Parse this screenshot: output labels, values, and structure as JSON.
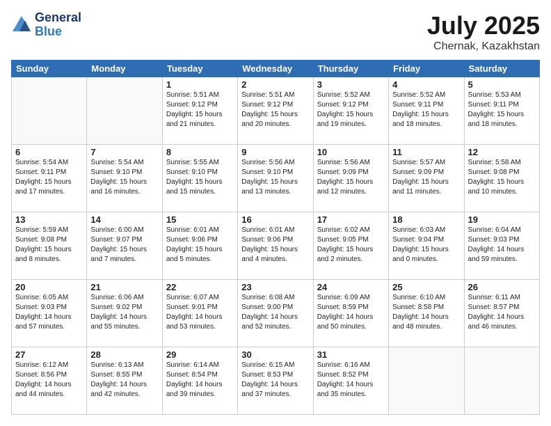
{
  "header": {
    "logo_line1": "General",
    "logo_line2": "Blue",
    "title": "July 2025",
    "subtitle": "Chernak, Kazakhstan"
  },
  "weekdays": [
    "Sunday",
    "Monday",
    "Tuesday",
    "Wednesday",
    "Thursday",
    "Friday",
    "Saturday"
  ],
  "weeks": [
    [
      {
        "day": "",
        "info": ""
      },
      {
        "day": "",
        "info": ""
      },
      {
        "day": "1",
        "info": "Sunrise: 5:51 AM\nSunset: 9:12 PM\nDaylight: 15 hours\nand 21 minutes."
      },
      {
        "day": "2",
        "info": "Sunrise: 5:51 AM\nSunset: 9:12 PM\nDaylight: 15 hours\nand 20 minutes."
      },
      {
        "day": "3",
        "info": "Sunrise: 5:52 AM\nSunset: 9:12 PM\nDaylight: 15 hours\nand 19 minutes."
      },
      {
        "day": "4",
        "info": "Sunrise: 5:52 AM\nSunset: 9:11 PM\nDaylight: 15 hours\nand 18 minutes."
      },
      {
        "day": "5",
        "info": "Sunrise: 5:53 AM\nSunset: 9:11 PM\nDaylight: 15 hours\nand 18 minutes."
      }
    ],
    [
      {
        "day": "6",
        "info": "Sunrise: 5:54 AM\nSunset: 9:11 PM\nDaylight: 15 hours\nand 17 minutes."
      },
      {
        "day": "7",
        "info": "Sunrise: 5:54 AM\nSunset: 9:10 PM\nDaylight: 15 hours\nand 16 minutes."
      },
      {
        "day": "8",
        "info": "Sunrise: 5:55 AM\nSunset: 9:10 PM\nDaylight: 15 hours\nand 15 minutes."
      },
      {
        "day": "9",
        "info": "Sunrise: 5:56 AM\nSunset: 9:10 PM\nDaylight: 15 hours\nand 13 minutes."
      },
      {
        "day": "10",
        "info": "Sunrise: 5:56 AM\nSunset: 9:09 PM\nDaylight: 15 hours\nand 12 minutes."
      },
      {
        "day": "11",
        "info": "Sunrise: 5:57 AM\nSunset: 9:09 PM\nDaylight: 15 hours\nand 11 minutes."
      },
      {
        "day": "12",
        "info": "Sunrise: 5:58 AM\nSunset: 9:08 PM\nDaylight: 15 hours\nand 10 minutes."
      }
    ],
    [
      {
        "day": "13",
        "info": "Sunrise: 5:59 AM\nSunset: 9:08 PM\nDaylight: 15 hours\nand 8 minutes."
      },
      {
        "day": "14",
        "info": "Sunrise: 6:00 AM\nSunset: 9:07 PM\nDaylight: 15 hours\nand 7 minutes."
      },
      {
        "day": "15",
        "info": "Sunrise: 6:01 AM\nSunset: 9:06 PM\nDaylight: 15 hours\nand 5 minutes."
      },
      {
        "day": "16",
        "info": "Sunrise: 6:01 AM\nSunset: 9:06 PM\nDaylight: 15 hours\nand 4 minutes."
      },
      {
        "day": "17",
        "info": "Sunrise: 6:02 AM\nSunset: 9:05 PM\nDaylight: 15 hours\nand 2 minutes."
      },
      {
        "day": "18",
        "info": "Sunrise: 6:03 AM\nSunset: 9:04 PM\nDaylight: 15 hours\nand 0 minutes."
      },
      {
        "day": "19",
        "info": "Sunrise: 6:04 AM\nSunset: 9:03 PM\nDaylight: 14 hours\nand 59 minutes."
      }
    ],
    [
      {
        "day": "20",
        "info": "Sunrise: 6:05 AM\nSunset: 9:03 PM\nDaylight: 14 hours\nand 57 minutes."
      },
      {
        "day": "21",
        "info": "Sunrise: 6:06 AM\nSunset: 9:02 PM\nDaylight: 14 hours\nand 55 minutes."
      },
      {
        "day": "22",
        "info": "Sunrise: 6:07 AM\nSunset: 9:01 PM\nDaylight: 14 hours\nand 53 minutes."
      },
      {
        "day": "23",
        "info": "Sunrise: 6:08 AM\nSunset: 9:00 PM\nDaylight: 14 hours\nand 52 minutes."
      },
      {
        "day": "24",
        "info": "Sunrise: 6:09 AM\nSunset: 8:59 PM\nDaylight: 14 hours\nand 50 minutes."
      },
      {
        "day": "25",
        "info": "Sunrise: 6:10 AM\nSunset: 8:58 PM\nDaylight: 14 hours\nand 48 minutes."
      },
      {
        "day": "26",
        "info": "Sunrise: 6:11 AM\nSunset: 8:57 PM\nDaylight: 14 hours\nand 46 minutes."
      }
    ],
    [
      {
        "day": "27",
        "info": "Sunrise: 6:12 AM\nSunset: 8:56 PM\nDaylight: 14 hours\nand 44 minutes."
      },
      {
        "day": "28",
        "info": "Sunrise: 6:13 AM\nSunset: 8:55 PM\nDaylight: 14 hours\nand 42 minutes."
      },
      {
        "day": "29",
        "info": "Sunrise: 6:14 AM\nSunset: 8:54 PM\nDaylight: 14 hours\nand 39 minutes."
      },
      {
        "day": "30",
        "info": "Sunrise: 6:15 AM\nSunset: 8:53 PM\nDaylight: 14 hours\nand 37 minutes."
      },
      {
        "day": "31",
        "info": "Sunrise: 6:16 AM\nSunset: 8:52 PM\nDaylight: 14 hours\nand 35 minutes."
      },
      {
        "day": "",
        "info": ""
      },
      {
        "day": "",
        "info": ""
      }
    ]
  ]
}
